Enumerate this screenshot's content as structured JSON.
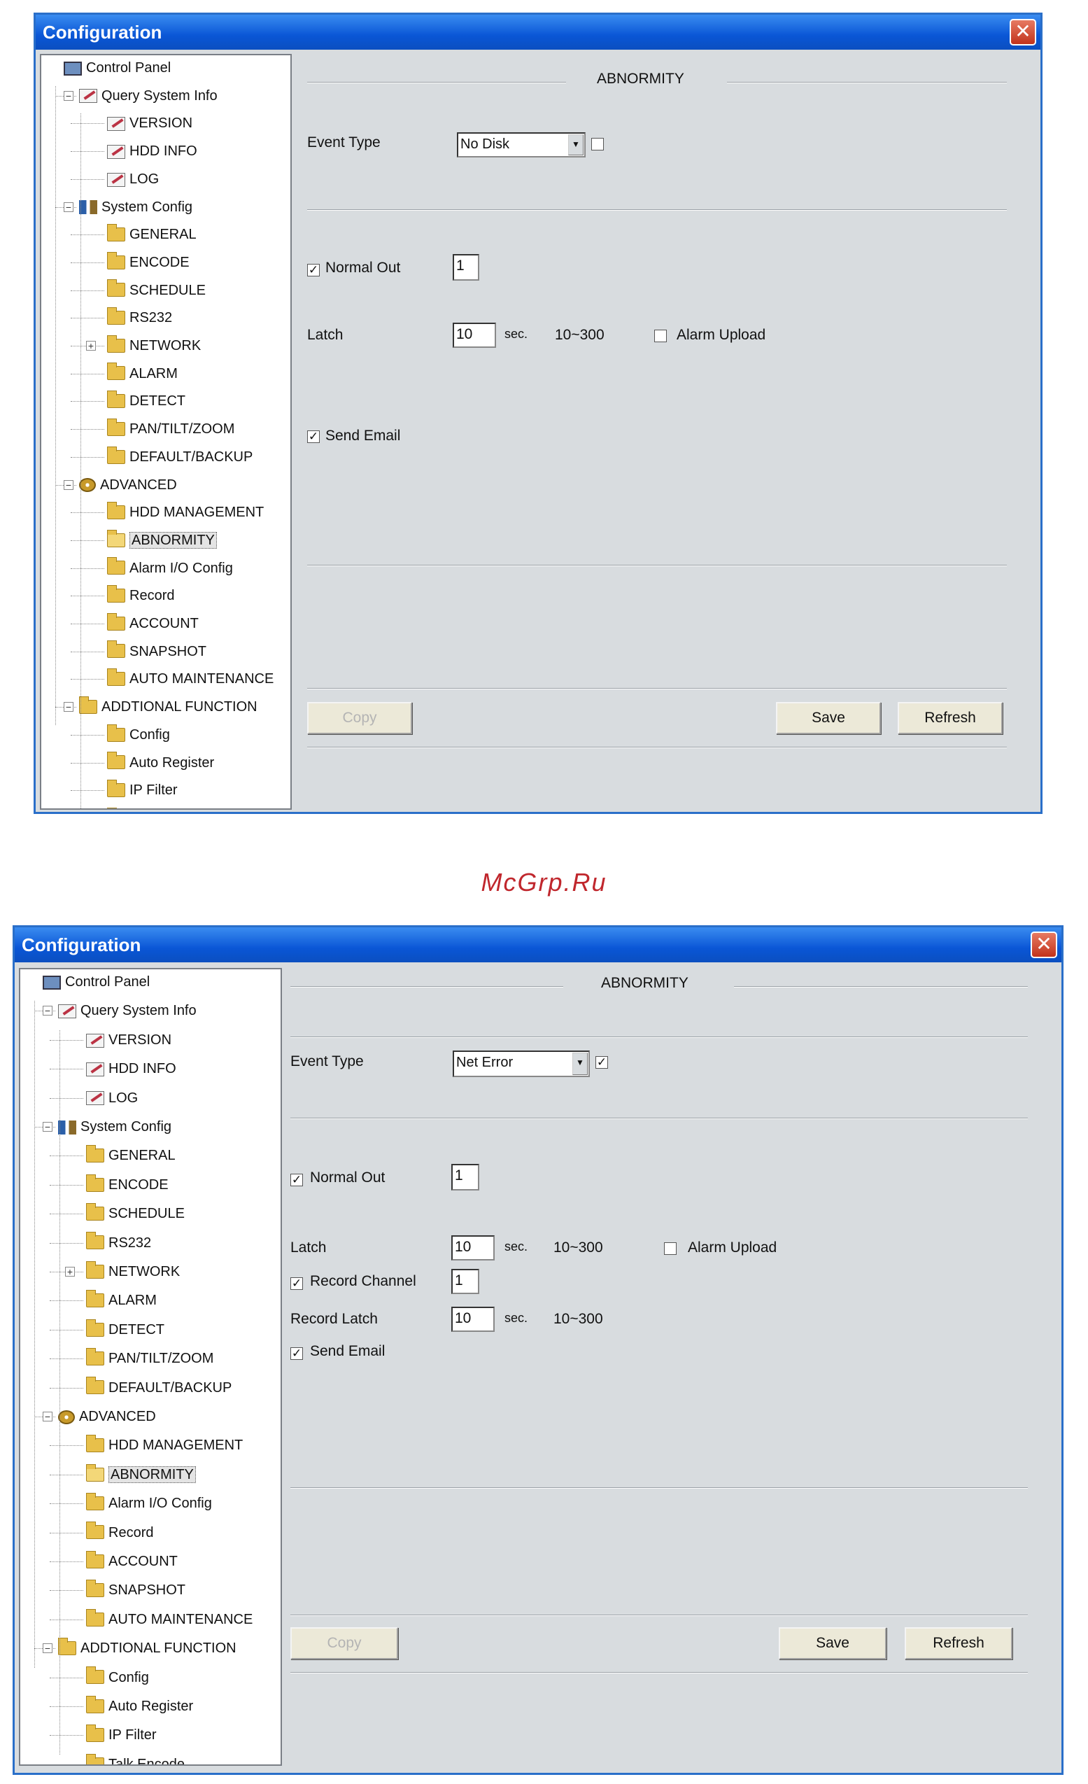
{
  "watermark": "McGrp.Ru",
  "window1": {
    "title": "Configuration",
    "close_glyph": "✕",
    "section_title": "ABNORMITY",
    "event_type_label": "Event Type",
    "event_type_value": "No Disk",
    "event_type_enabled": false,
    "normal_out_label": "Normal Out",
    "normal_out_checked": true,
    "normal_out_value": "1",
    "latch_label": "Latch",
    "latch_value": "10",
    "latch_unit": "sec.",
    "latch_range": "10~300",
    "alarm_upload_label": "Alarm Upload",
    "alarm_upload_checked": false,
    "send_email_label": "Send Email",
    "send_email_checked": true,
    "copy_label": "Copy",
    "save_label": "Save",
    "refresh_label": "Refresh"
  },
  "window2": {
    "title": "Configuration",
    "close_glyph": "✕",
    "section_title": "ABNORMITY",
    "event_type_label": "Event Type",
    "event_type_value": "Net Error",
    "event_type_enabled": true,
    "normal_out_label": "Normal Out",
    "normal_out_checked": true,
    "normal_out_value": "1",
    "latch_label": "Latch",
    "latch_value": "10",
    "latch_unit": "sec.",
    "latch_range": "10~300",
    "alarm_upload_label": "Alarm Upload",
    "alarm_upload_checked": false,
    "record_channel_label": "Record Channel",
    "record_channel_checked": true,
    "record_channel_value": "1",
    "record_latch_label": "Record Latch",
    "record_latch_value": "10",
    "record_latch_unit": "sec.",
    "record_latch_range": "10~300",
    "send_email_label": "Send Email",
    "send_email_checked": true,
    "copy_label": "Copy",
    "save_label": "Save",
    "refresh_label": "Refresh"
  },
  "tree": [
    {
      "label": "Control Panel",
      "level": 0,
      "icon": "monitor-icon",
      "expander": ""
    },
    {
      "label": "Query System Info",
      "level": 1,
      "icon": "doc-icon",
      "expander": "−"
    },
    {
      "label": "VERSION",
      "level": 2,
      "icon": "doc-icon",
      "expander": ""
    },
    {
      "label": "HDD INFO",
      "level": 2,
      "icon": "doc-icon",
      "expander": ""
    },
    {
      "label": "LOG",
      "level": 2,
      "icon": "doc-icon",
      "expander": ""
    },
    {
      "label": "System Config",
      "level": 1,
      "icon": "tools-icon",
      "expander": "−"
    },
    {
      "label": "GENERAL",
      "level": 2,
      "icon": "folder-icon",
      "expander": ""
    },
    {
      "label": "ENCODE",
      "level": 2,
      "icon": "folder-icon",
      "expander": ""
    },
    {
      "label": "SCHEDULE",
      "level": 2,
      "icon": "folder-icon",
      "expander": ""
    },
    {
      "label": "RS232",
      "level": 2,
      "icon": "folder-icon",
      "expander": ""
    },
    {
      "label": "NETWORK",
      "level": 2,
      "icon": "folder-icon",
      "expander": "+"
    },
    {
      "label": "ALARM",
      "level": 2,
      "icon": "folder-icon",
      "expander": ""
    },
    {
      "label": "DETECT",
      "level": 2,
      "icon": "folder-icon",
      "expander": ""
    },
    {
      "label": "PAN/TILT/ZOOM",
      "level": 2,
      "icon": "folder-icon",
      "expander": ""
    },
    {
      "label": "DEFAULT/BACKUP",
      "level": 2,
      "icon": "folder-icon",
      "expander": ""
    },
    {
      "label": "ADVANCED",
      "level": 1,
      "icon": "gear-icon",
      "expander": "−"
    },
    {
      "label": "HDD MANAGEMENT",
      "level": 2,
      "icon": "folder-icon",
      "expander": ""
    },
    {
      "label": "ABNORMITY",
      "level": 2,
      "icon": "folder-open-icon",
      "expander": "",
      "selected": true
    },
    {
      "label": "Alarm I/O Config",
      "level": 2,
      "icon": "folder-icon",
      "expander": ""
    },
    {
      "label": "Record",
      "level": 2,
      "icon": "folder-icon",
      "expander": ""
    },
    {
      "label": "ACCOUNT",
      "level": 2,
      "icon": "folder-icon",
      "expander": ""
    },
    {
      "label": "SNAPSHOT",
      "level": 2,
      "icon": "folder-icon",
      "expander": ""
    },
    {
      "label": "AUTO MAINTENANCE",
      "level": 2,
      "icon": "folder-icon",
      "expander": ""
    },
    {
      "label": "ADDTIONAL FUNCTION",
      "level": 1,
      "icon": "folder-icon",
      "expander": "−"
    },
    {
      "label": "Config",
      "level": 2,
      "icon": "folder-icon",
      "expander": ""
    },
    {
      "label": "Auto Register",
      "level": 2,
      "icon": "folder-icon",
      "expander": ""
    },
    {
      "label": "IP Filter",
      "level": 2,
      "icon": "folder-icon",
      "expander": ""
    },
    {
      "label": "Talk Encode",
      "level": 2,
      "icon": "folder-icon",
      "expander": ""
    }
  ]
}
